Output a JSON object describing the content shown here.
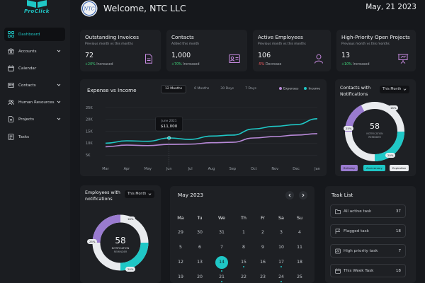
{
  "app": {
    "name": "ProClick"
  },
  "header": {
    "welcome": "Welcome, NTC LLC",
    "date": "May, 21 2023",
    "logo_text": "NTC"
  },
  "sidebar": {
    "items": [
      {
        "label": "Dashboard",
        "icon": "grid-icon",
        "active": true,
        "expandable": false
      },
      {
        "label": "Accounts",
        "icon": "bank-icon",
        "active": false,
        "expandable": true
      },
      {
        "label": "Calendar",
        "icon": "calendar-icon",
        "active": false,
        "expandable": false
      },
      {
        "label": "Contacts",
        "icon": "contact-card-icon",
        "active": false,
        "expandable": true
      },
      {
        "label": "Human Resources",
        "icon": "people-icon",
        "active": false,
        "expandable": true
      },
      {
        "label": "Projects",
        "icon": "document-icon",
        "active": false,
        "expandable": true
      },
      {
        "label": "Tasks",
        "icon": "task-list-icon",
        "active": false,
        "expandable": false
      }
    ]
  },
  "stats": [
    {
      "title": "Outstanding Invoices",
      "subtitle": "Previous month vs this months",
      "value": "72",
      "change": "+20%",
      "change_suffix": " Increased",
      "trend": "up",
      "icon": "invoice-icon"
    },
    {
      "title": "Contacts",
      "subtitle": "Added this month",
      "value": "1,000",
      "change": "+70%",
      "change_suffix": " Increased",
      "trend": "up",
      "icon": "contact-card-icon"
    },
    {
      "title": "Active Employees",
      "subtitle": "Previous month vs this months",
      "value": "106",
      "change": "-5%",
      "change_suffix": " Decrease",
      "trend": "down",
      "icon": "person-icon"
    },
    {
      "title": "High-Priority Open Projects",
      "subtitle": "Previous month vs this months",
      "value": "13",
      "change": "+10%",
      "change_suffix": " Increased",
      "trend": "up",
      "icon": "presentation-icon"
    }
  ],
  "expense_chart": {
    "title": "Expense vs Income",
    "tabs": [
      "12 Months",
      "6 Months",
      "30 Days",
      "7 Days"
    ],
    "active_tab": "12 Months",
    "tooltip": {
      "label": "June 2021",
      "value": "$11,000"
    }
  },
  "chart_data": {
    "type": "line",
    "title": "Expense vs Income",
    "categories": [
      "Mar",
      "Apr",
      "May",
      "Jun",
      "Jul",
      "Aug",
      "Sep",
      "Oct",
      "Nov",
      "Dec",
      "Jan"
    ],
    "y_ticks": [
      "25K",
      "20K",
      "15K",
      "10K",
      "5K"
    ],
    "ylim": [
      0,
      25000
    ],
    "grid": true,
    "legend": "top-right",
    "series": [
      {
        "name": "Expenses",
        "color": "#b889d8",
        "values": [
          8500,
          9200,
          9000,
          9500,
          9600,
          10200,
          10400,
          12200,
          12800,
          13400,
          14000
        ]
      },
      {
        "name": "Income",
        "color": "#1fc7c6",
        "values": [
          10000,
          11000,
          10800,
          12200,
          11600,
          13000,
          13400,
          16000,
          17100,
          17800,
          20300
        ]
      }
    ]
  },
  "contacts_donut": {
    "title_line1": "Contacts with",
    "title_line2": "Notifications",
    "filter": "This Month",
    "center_value": "58",
    "center_line1": "NOTIFICATION",
    "center_line2": "REMINDER",
    "segments": [
      {
        "name": "Birthday",
        "percent": 25,
        "color": "#9a7bd0"
      },
      {
        "name": "Anniversary",
        "percent": 20,
        "color": "#1fc7c6"
      },
      {
        "name": "Expiration",
        "percent": 55,
        "color": "#e9ebee"
      }
    ],
    "labels": [
      "18%",
      "25%",
      "20%"
    ]
  },
  "employees_donut": {
    "title_line1": "Employees with",
    "title_line2": "notifications",
    "filter": "This Month",
    "center_value": "58",
    "center_line1": "NOTIFICATION",
    "center_line2": "REMINDER",
    "labels": [
      "18%",
      "25%",
      "20%"
    ]
  },
  "calendar": {
    "month": "May 2023",
    "weekdays": [
      "Ma",
      "Tu",
      "We",
      "Th",
      "Fr",
      "Sa",
      "Su"
    ],
    "weeks": [
      [
        "29",
        "30",
        "31",
        "1",
        "2",
        "3",
        "4"
      ],
      [
        "5",
        "6",
        "7",
        "8",
        "9",
        "10",
        "11"
      ],
      [
        "12",
        "13",
        "14",
        "15",
        "16",
        "17",
        "18"
      ],
      [
        "19",
        "20",
        "21",
        "22",
        "23",
        "24",
        "25"
      ]
    ],
    "selected": "14",
    "dotted": [
      "14",
      "15",
      "17",
      "21",
      "24"
    ]
  },
  "tasks": {
    "title": "Task List",
    "items": [
      {
        "label": "All active task",
        "count": "37",
        "icon": "folder-icon"
      },
      {
        "label": "Flagged task",
        "count": "18",
        "icon": "flag-icon"
      },
      {
        "label": "High priority task",
        "count": "7",
        "icon": "priority-icon"
      },
      {
        "label": "This Week Task",
        "count": "18",
        "icon": "calendar-icon"
      }
    ]
  }
}
